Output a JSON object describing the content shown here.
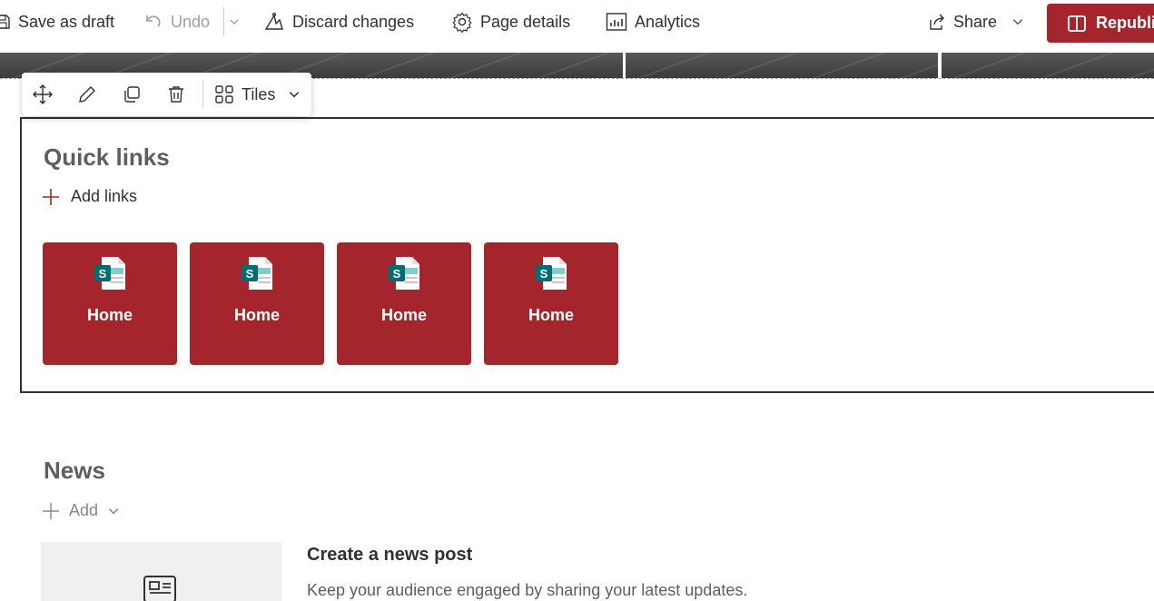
{
  "toolbar": {
    "save_draft": "Save as draft",
    "undo": "Undo",
    "discard": "Discard changes",
    "page_details": "Page details",
    "analytics": "Analytics",
    "share": "Share",
    "republish": "Republi"
  },
  "webpart_toolbar": {
    "layout_label": "Tiles",
    "icons": [
      "move-icon",
      "edit-icon",
      "duplicate-icon",
      "delete-icon",
      "tiles-layout-icon",
      "chevron-down-icon"
    ]
  },
  "quick_links": {
    "title": "Quick links",
    "add_links": "Add links",
    "tiles": [
      {
        "label": "Home"
      },
      {
        "label": "Home"
      },
      {
        "label": "Home"
      },
      {
        "label": "Home"
      }
    ]
  },
  "news": {
    "title": "News",
    "add": "Add",
    "post_title": "Create a news post",
    "post_description": "Keep your audience engaged by sharing your latest updates."
  },
  "colors": {
    "accent": "#a4262c",
    "text": "#323130",
    "muted": "#605e5c",
    "disabled": "#a19f9d"
  }
}
